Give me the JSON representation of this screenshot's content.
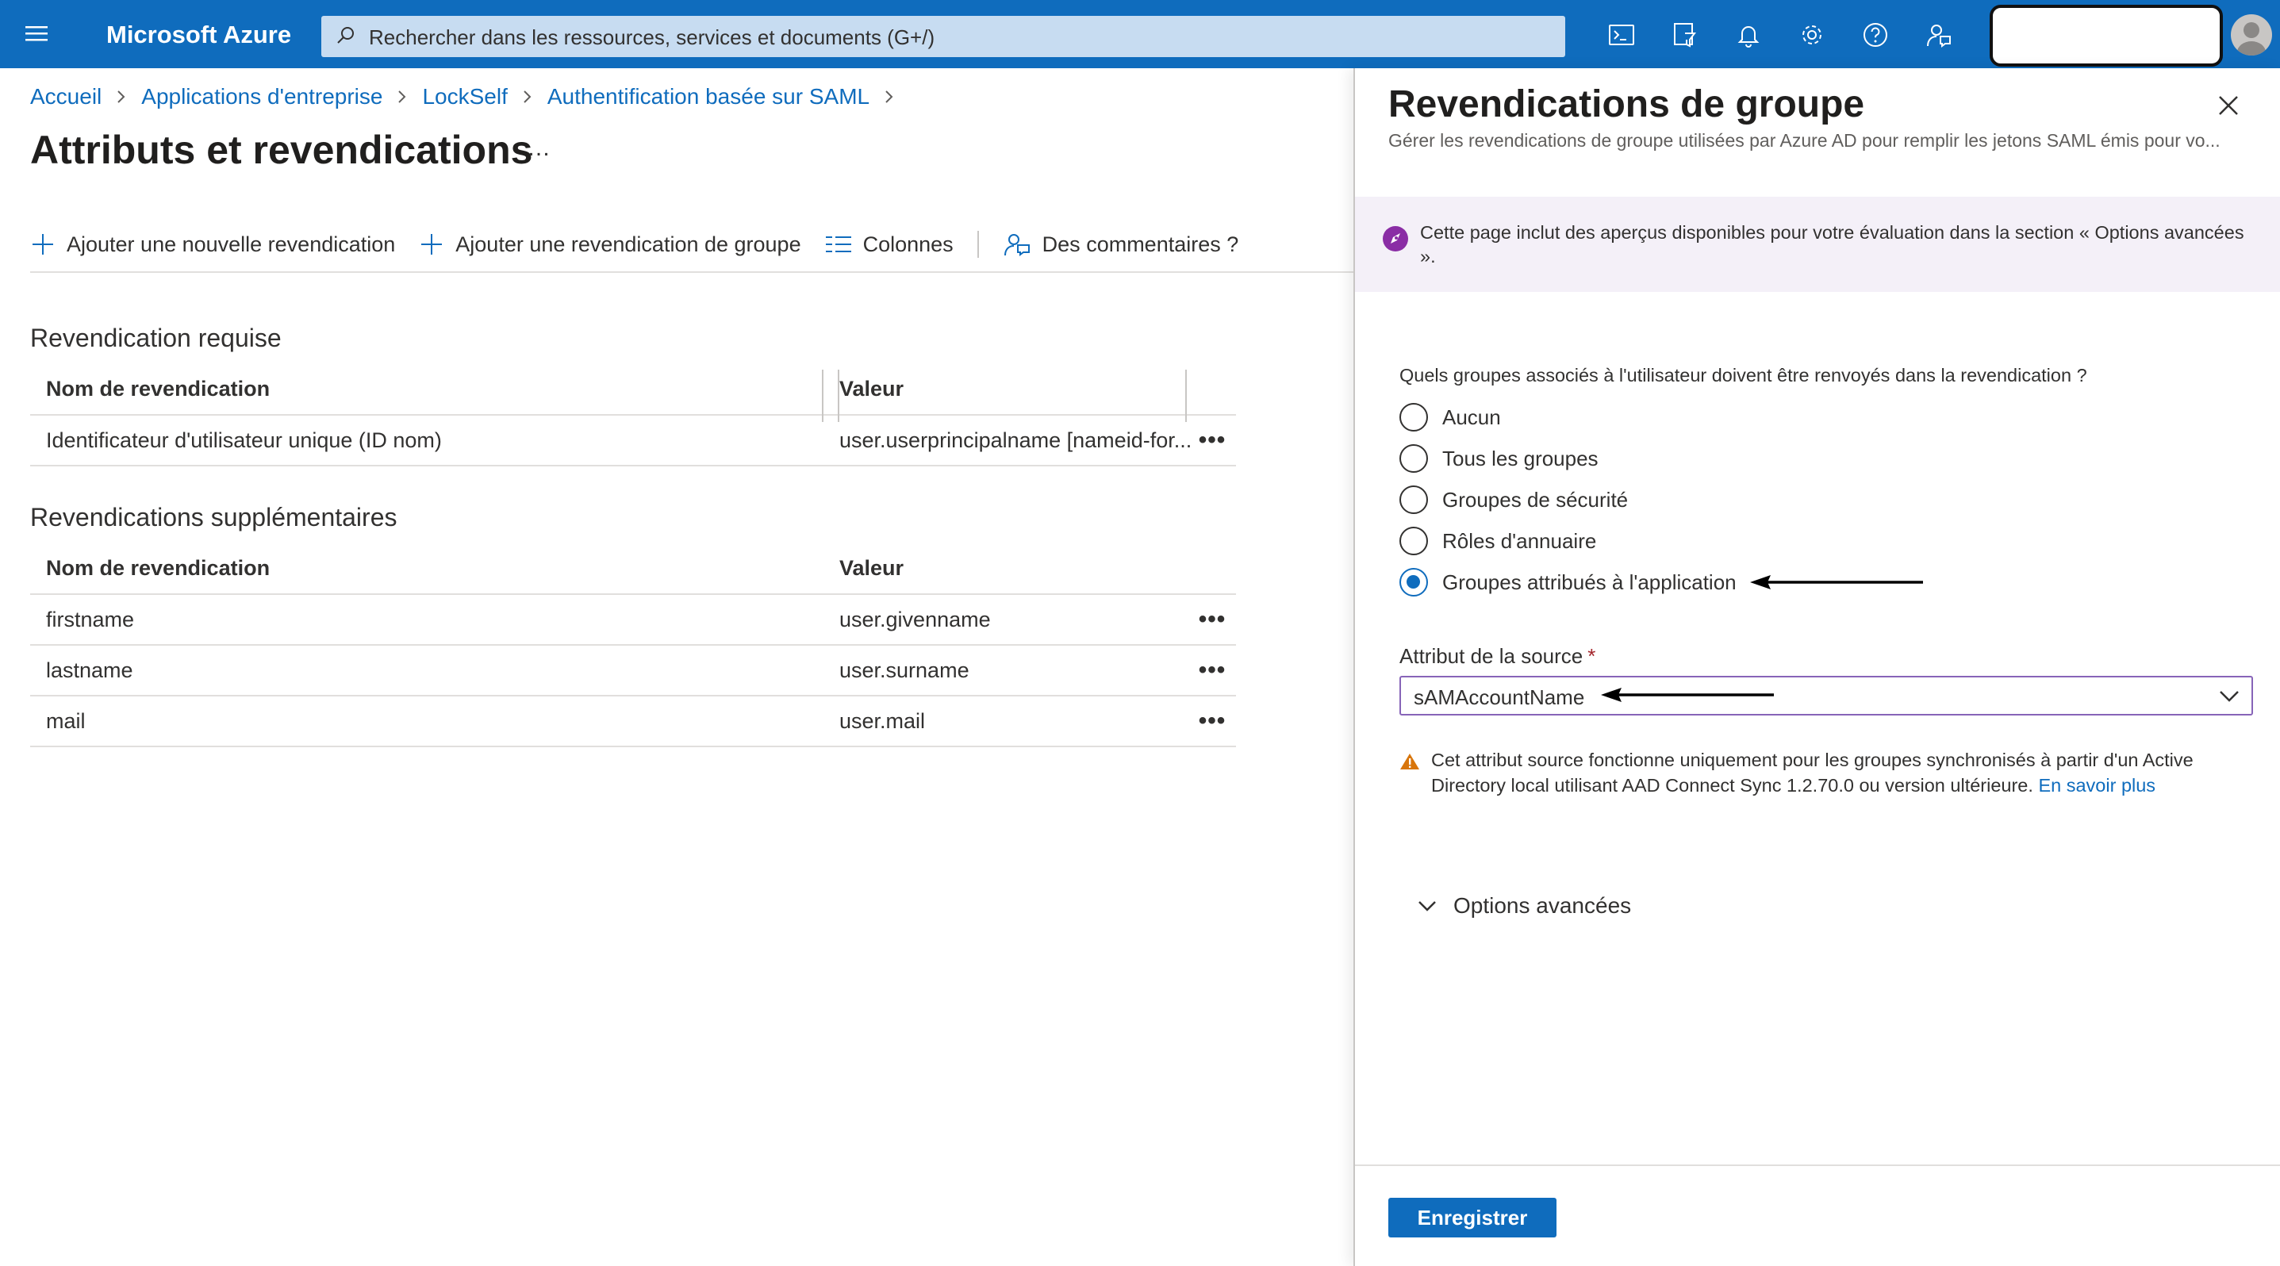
{
  "topbar": {
    "brand": "Microsoft Azure",
    "search_placeholder": "Rechercher dans les ressources, services et documents (G+/)",
    "icons": [
      "hamburger-menu-icon",
      "cloud-shell-icon",
      "directory-filter-icon",
      "notifications-icon",
      "settings-icon",
      "help-icon",
      "feedback-icon"
    ]
  },
  "breadcrumb": [
    "Accueil",
    "Applications d'entreprise",
    "LockSelf",
    "Authentification basée sur SAML"
  ],
  "page": {
    "title": "Attributs et revendications",
    "more": "…"
  },
  "commands": {
    "add_claim": "Ajouter une nouvelle revendication",
    "add_group_claim": "Ajouter une revendication de groupe",
    "columns": "Colonnes",
    "feedback": "Des commentaires ?"
  },
  "required": {
    "title": "Revendication requise",
    "headers": [
      "Nom de revendication",
      "Valeur"
    ],
    "rows": [
      {
        "name": "Identificateur d'utilisateur unique (ID nom)",
        "value": "user.userprincipalname [nameid-for..."
      }
    ]
  },
  "additional": {
    "title": "Revendications supplémentaires",
    "headers": [
      "Nom de revendication",
      "Valeur"
    ],
    "rows": [
      {
        "name": "firstname",
        "value": "user.givenname"
      },
      {
        "name": "lastname",
        "value": "user.surname"
      },
      {
        "name": "mail",
        "value": "user.mail"
      }
    ]
  },
  "row_more": "•••",
  "panel": {
    "title": "Revendications de groupe",
    "subtitle": "Gérer les revendications de groupe utilisées par Azure AD pour remplir les jetons SAML émis pour vo...",
    "banner": "Cette page inclut des aperçus disponibles pour votre évaluation dans la section « Options avancées ».",
    "question": "Quels groupes associés à l'utilisateur doivent être renvoyés dans la revendication ?",
    "options": [
      "Aucun",
      "Tous les groupes",
      "Groupes de sécurité",
      "Rôles d'annuaire",
      "Groupes attribués à l'application"
    ],
    "selected_option": "Groupes attribués à l'application",
    "source_label": "Attribut de la source",
    "required_mark": "*",
    "source_value": "sAMAccountName",
    "warning": "Cet attribut source fonctionne uniquement pour les groupes synchronisés à partir d'un Active Directory local utilisant AAD Connect Sync 1.2.70.0 ou version ultérieure.",
    "learn_more": "En savoir plus",
    "advanced": "Options avancées",
    "save": "Enregistrer",
    "colors": {
      "accent": "#0f6cbd",
      "select_border": "#8764b8",
      "banner_bg": "#f4f0f8",
      "banner_icon": "#8a2da5",
      "warning": "#d8750b"
    }
  }
}
